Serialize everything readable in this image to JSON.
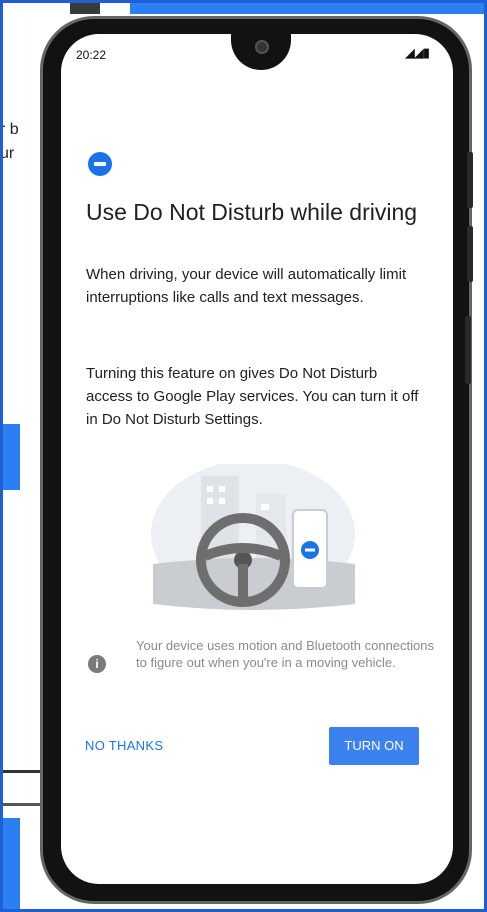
{
  "status_bar": {
    "time": "20:22",
    "signal_glyph": "◢◢▮"
  },
  "background": {
    "left_text_line1": "r b",
    "left_text_line2": "ur"
  },
  "dialog": {
    "icon": "do-not-disturb-icon",
    "title": "Use Do Not Disturb while driving",
    "body1": "When driving, your device will automatically limit interruptions like calls and text messages.",
    "body2": "Turning this feature on gives Do Not Disturb access to Google Play services. You can turn it off in Do Not Disturb Settings.",
    "info_icon_glyph": "i",
    "info_text": "Your device uses motion and Bluetooth connections to figure out when you're in a moving vehicle.",
    "no_thanks_label": "NO THANKS",
    "turn_on_label": "TURN ON"
  },
  "colors": {
    "accent": "#1a73e8",
    "button_bg": "#3b82f0",
    "frame_border": "#1f5fd6"
  }
}
